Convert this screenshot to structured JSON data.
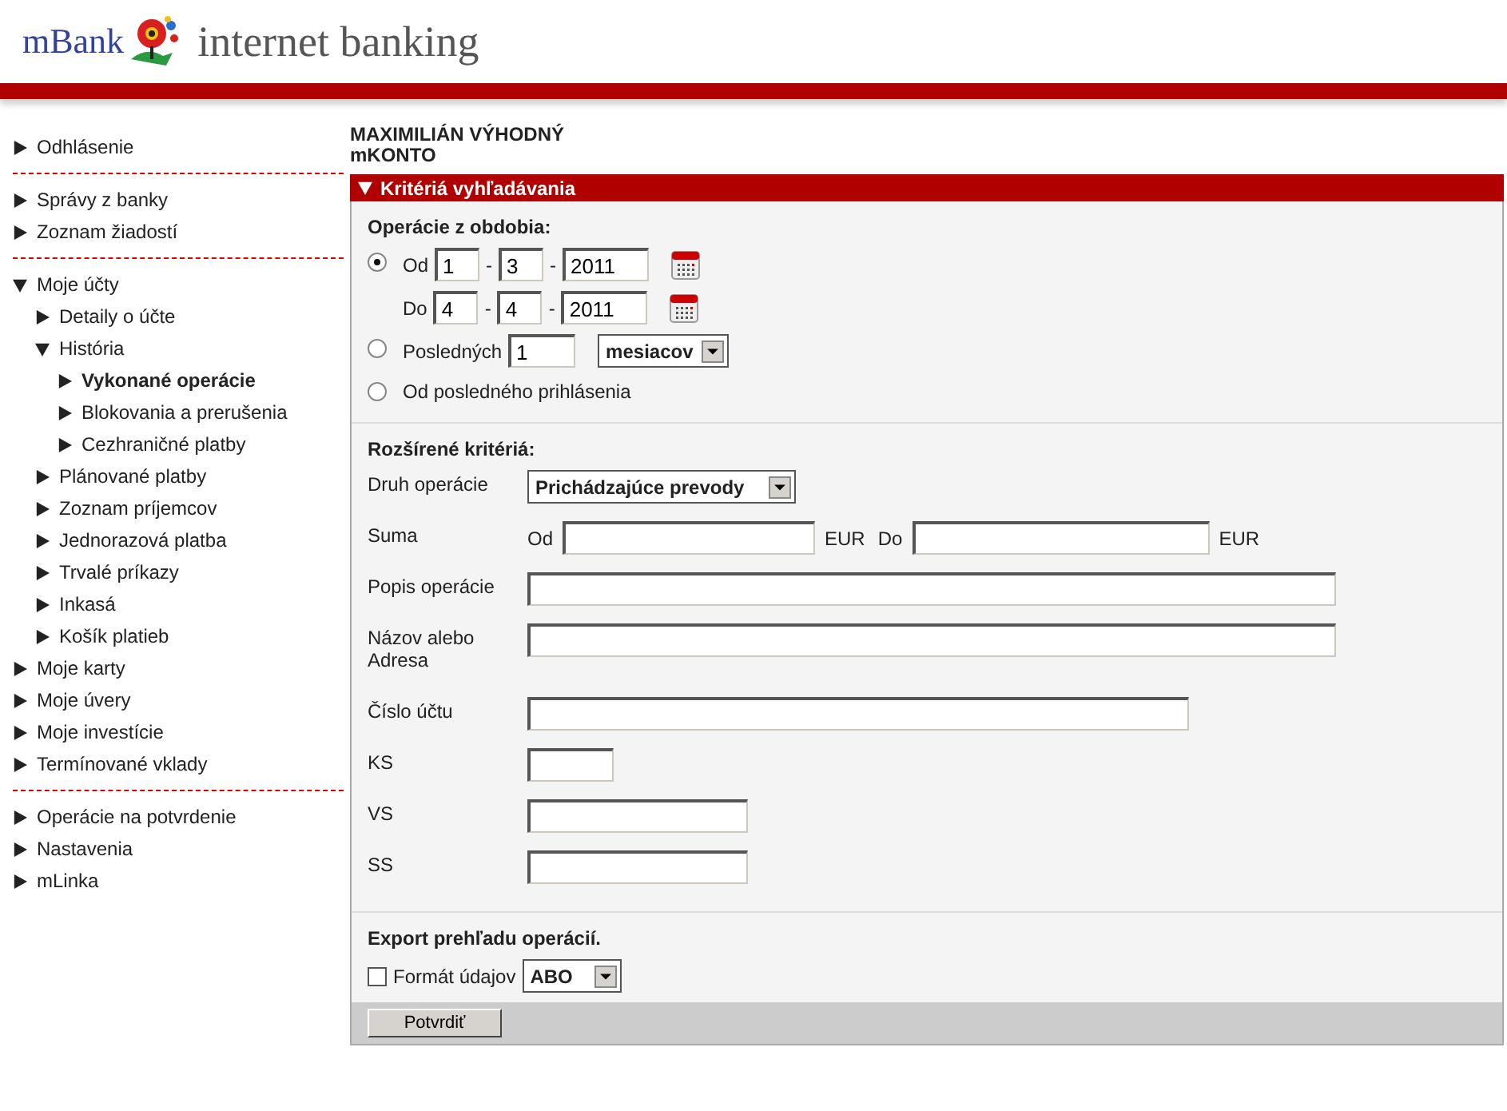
{
  "header": {
    "brand": "mBank",
    "tagline": "internet banking"
  },
  "sidebar": {
    "sections": [
      {
        "items": [
          {
            "label": "Odhlásenie",
            "expanded": false,
            "selected": false
          }
        ]
      },
      {
        "items": [
          {
            "label": "Správy z banky",
            "expanded": false,
            "selected": false
          },
          {
            "label": "Zoznam žiadostí",
            "expanded": false,
            "selected": false
          }
        ]
      },
      {
        "items": [
          {
            "label": "Moje účty",
            "expanded": true,
            "selected": false,
            "children": [
              {
                "label": "Detaily o účte",
                "expanded": false,
                "selected": false
              },
              {
                "label": "História",
                "expanded": true,
                "selected": false,
                "children": [
                  {
                    "label": "Vykonané operácie",
                    "expanded": false,
                    "selected": true
                  },
                  {
                    "label": "Blokovania a prerušenia",
                    "expanded": false,
                    "selected": false
                  },
                  {
                    "label": "Cezhraničné platby",
                    "expanded": false,
                    "selected": false
                  }
                ]
              },
              {
                "label": "Plánované platby",
                "expanded": false,
                "selected": false
              },
              {
                "label": "Zoznam príjemcov",
                "expanded": false,
                "selected": false
              },
              {
                "label": "Jednorazová platba",
                "expanded": false,
                "selected": false
              },
              {
                "label": "Trvalé príkazy",
                "expanded": false,
                "selected": false
              },
              {
                "label": "Inkasá",
                "expanded": false,
                "selected": false
              },
              {
                "label": "Košík platieb",
                "expanded": false,
                "selected": false
              }
            ]
          },
          {
            "label": "Moje karty",
            "expanded": false,
            "selected": false
          },
          {
            "label": "Moje úvery",
            "expanded": false,
            "selected": false
          },
          {
            "label": "Moje investície",
            "expanded": false,
            "selected": false
          },
          {
            "label": "Termínované vklady",
            "expanded": false,
            "selected": false
          }
        ]
      },
      {
        "items": [
          {
            "label": "Operácie na potvrdenie",
            "expanded": false,
            "selected": false
          },
          {
            "label": "Nastavenia",
            "expanded": false,
            "selected": false
          },
          {
            "label": "mLinka",
            "expanded": false,
            "selected": false
          }
        ]
      }
    ]
  },
  "main": {
    "account_owner": "MAXIMILIÁN VÝHODNÝ",
    "account_name": "mKONTO",
    "panel": {
      "title": "Kritériá vyhľadávania",
      "expanded": true,
      "period": {
        "heading": "Operácie z obdobia:",
        "options": [
          {
            "kind": "range",
            "selected": true,
            "rows": [
              {
                "label": "Od",
                "day": "1",
                "month": "3",
                "year": "2011",
                "separators": [
                  "-",
                  "-"
                ]
              },
              {
                "label": "Do",
                "day": "4",
                "month": "4",
                "year": "2011",
                "separators": [
                  "-",
                  "-"
                ]
              }
            ]
          },
          {
            "kind": "last",
            "selected": false,
            "label": "Posledných",
            "value": "1",
            "unit": "mesiacov"
          },
          {
            "kind": "since_login",
            "selected": false,
            "label": "Od posledného prihlásenia"
          }
        ]
      },
      "extended": {
        "heading": "Rozšírené kritériá:",
        "rows": [
          {
            "kind": "select",
            "label": "Druh operácie",
            "value": "Prichádzajúce prevody"
          },
          {
            "kind": "amount",
            "label": "Suma",
            "from_label": "Od",
            "currency_from": "EUR",
            "to_label": "Do",
            "currency_to": "EUR"
          },
          {
            "kind": "text",
            "label": "Popis operácie"
          },
          {
            "kind": "text",
            "label": "Názov alebo Adresa"
          },
          {
            "kind": "text",
            "label": "Číslo účtu"
          },
          {
            "kind": "text",
            "label": "KS"
          },
          {
            "kind": "text",
            "label": "VS"
          },
          {
            "kind": "text",
            "label": "SS"
          }
        ]
      },
      "export": {
        "heading": "Export prehľadu operácií.",
        "checkbox": {
          "label": "Formát údajov",
          "checked": false
        },
        "format": "ABO"
      },
      "submit": "Potvrdiť"
    }
  }
}
